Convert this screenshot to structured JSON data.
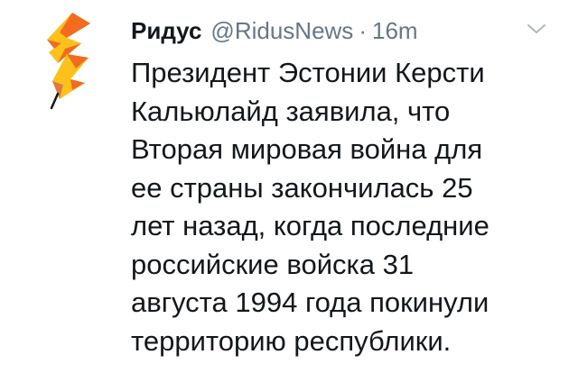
{
  "tweet": {
    "author_name": "Ридус",
    "handle": "@RidusNews",
    "separator": "·",
    "time": "16m",
    "lines": [
      "Президент Эстонии Керсти",
      "Кальюлайд заявила, что",
      "Вторая мировая война для",
      "ее страны закончилась 25",
      "лет назад, когда последние",
      "российские войска 31",
      "августа 1994 года покинули",
      "территорию республики."
    ]
  },
  "icons": {
    "avatar": "lightning-pencil-logo",
    "menu": "chevron-down-icon"
  },
  "colors": {
    "text": "#14171a",
    "secondary": "#657786",
    "logo_orange": "#f26b21",
    "logo_yellow": "#fcc21b",
    "caret": "#aab8c2"
  }
}
